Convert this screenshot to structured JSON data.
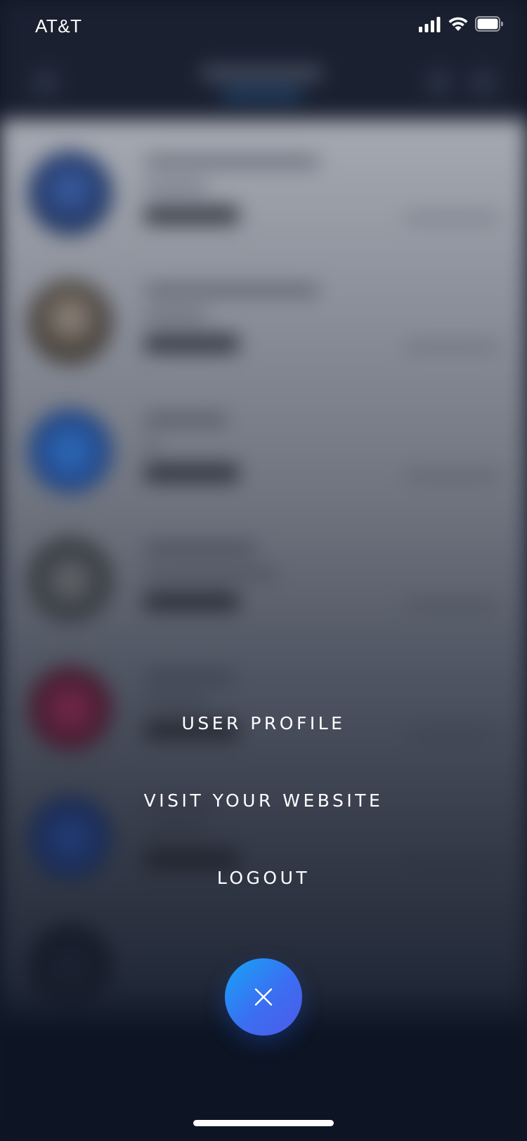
{
  "status_bar": {
    "carrier": "AT&T",
    "signal_icon": "cellular-signal-icon",
    "wifi_icon": "wifi-icon",
    "battery_icon": "battery-full-icon"
  },
  "menu": {
    "items": [
      {
        "label": "USER PROFILE"
      },
      {
        "label": "VISIT YOUR WEBSITE"
      },
      {
        "label": "LOGOUT"
      }
    ]
  },
  "close_button": {
    "icon": "close-icon",
    "gradient_start": "#16a5f6",
    "gradient_end": "#4e5ae8"
  },
  "colors": {
    "overlay_top": "#a4a8b1",
    "overlay_bottom": "#0d1524",
    "text": "#ffffff"
  }
}
